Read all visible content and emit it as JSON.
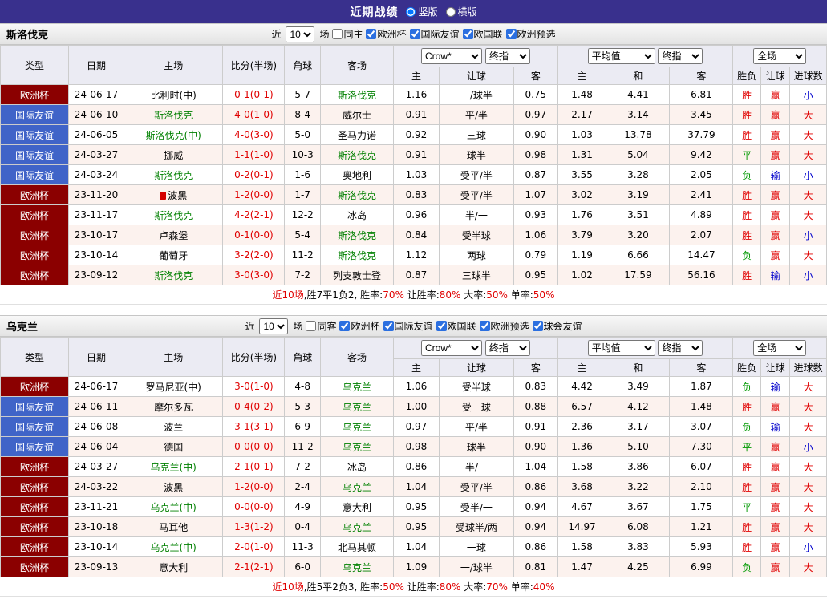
{
  "top_bar": {
    "title": "近期战绩",
    "layout_options": [
      {
        "label": "竖版",
        "selected": true
      },
      {
        "label": "横版",
        "selected": false
      }
    ]
  },
  "table_header": {
    "type": "类型",
    "date": "日期",
    "home": "主场",
    "score": "比分(半场)",
    "corner": "角球",
    "away": "客场",
    "ah_home": "主",
    "ah_line": "让球",
    "ah_away": "客",
    "eu_home": "主",
    "eu_draw": "和",
    "eu_away": "客",
    "res_wdl": "胜负",
    "res_handicap": "让球",
    "res_goals": "进球数",
    "select_company": "Crow*",
    "select_final": "终指",
    "select_average": "平均值",
    "select_fulltime": "全场"
  },
  "colors": {
    "euro_cup_bg": "#8b0000",
    "friendly_bg": "#4064c8",
    "focus_team_green": "#008000",
    "score_red": "#e00000",
    "win_red": "#e00000",
    "draw_lose_green": "#009900",
    "lose_small_blue": "#0000cc",
    "top_bar_purple": "#39308d"
  },
  "sections": [
    {
      "team": "斯洛伐克",
      "filter": {
        "near": "近",
        "count": "10",
        "unit": "场",
        "same": "同主",
        "same_checked": false,
        "leagues": [
          "欧洲杯",
          "国际友谊",
          "欧国联",
          "欧洲预选"
        ]
      },
      "rows": [
        {
          "type": "欧洲杯",
          "date": "24-06-17",
          "home": "比利时(中)",
          "home_focus": false,
          "home_icon": false,
          "score": "0-1(0-1)",
          "corner": "5-7",
          "away": "斯洛伐克",
          "away_focus": true,
          "odds": [
            "1.16",
            "一/球半",
            "0.75"
          ],
          "euro": [
            "1.48",
            "4.41",
            "6.81"
          ],
          "results": [
            "胜",
            "赢",
            "小"
          ]
        },
        {
          "type": "国际友谊",
          "date": "24-06-10",
          "home": "斯洛伐克",
          "home_focus": true,
          "home_icon": false,
          "score": "4-0(1-0)",
          "corner": "8-4",
          "away": "威尔士",
          "away_focus": false,
          "odds": [
            "0.91",
            "平/半",
            "0.97"
          ],
          "euro": [
            "2.17",
            "3.14",
            "3.45"
          ],
          "results": [
            "胜",
            "赢",
            "大"
          ]
        },
        {
          "type": "国际友谊",
          "date": "24-06-05",
          "home": "斯洛伐克(中)",
          "home_focus": true,
          "home_icon": false,
          "score": "4-0(3-0)",
          "corner": "5-0",
          "away": "圣马力诺",
          "away_focus": false,
          "odds": [
            "0.92",
            "三球",
            "0.90"
          ],
          "euro": [
            "1.03",
            "13.78",
            "37.79"
          ],
          "results": [
            "胜",
            "赢",
            "大"
          ]
        },
        {
          "type": "国际友谊",
          "date": "24-03-27",
          "home": "挪威",
          "home_focus": false,
          "home_icon": false,
          "score": "1-1(1-0)",
          "corner": "10-3",
          "away": "斯洛伐克",
          "away_focus": true,
          "odds": [
            "0.91",
            "球半",
            "0.98"
          ],
          "euro": [
            "1.31",
            "5.04",
            "9.42"
          ],
          "results": [
            "平",
            "赢",
            "大"
          ]
        },
        {
          "type": "国际友谊",
          "date": "24-03-24",
          "home": "斯洛伐克",
          "home_focus": true,
          "home_icon": false,
          "score": "0-2(0-1)",
          "corner": "1-6",
          "away": "奥地利",
          "away_focus": false,
          "odds": [
            "1.03",
            "受平/半",
            "0.87"
          ],
          "euro": [
            "3.55",
            "3.28",
            "2.05"
          ],
          "results": [
            "负",
            "输",
            "小"
          ]
        },
        {
          "type": "欧洲杯",
          "date": "23-11-20",
          "home": "波黑",
          "home_focus": false,
          "home_icon": true,
          "score": "1-2(0-0)",
          "corner": "1-7",
          "away": "斯洛伐克",
          "away_focus": true,
          "odds": [
            "0.83",
            "受平/半",
            "1.07"
          ],
          "euro": [
            "3.02",
            "3.19",
            "2.41"
          ],
          "results": [
            "胜",
            "赢",
            "大"
          ]
        },
        {
          "type": "欧洲杯",
          "date": "23-11-17",
          "home": "斯洛伐克",
          "home_focus": true,
          "home_icon": false,
          "score": "4-2(2-1)",
          "corner": "12-2",
          "away": "冰岛",
          "away_focus": false,
          "odds": [
            "0.96",
            "半/一",
            "0.93"
          ],
          "euro": [
            "1.76",
            "3.51",
            "4.89"
          ],
          "results": [
            "胜",
            "赢",
            "大"
          ]
        },
        {
          "type": "欧洲杯",
          "date": "23-10-17",
          "home": "卢森堡",
          "home_focus": false,
          "home_icon": false,
          "score": "0-1(0-0)",
          "corner": "5-4",
          "away": "斯洛伐克",
          "away_focus": true,
          "odds": [
            "0.84",
            "受半球",
            "1.06"
          ],
          "euro": [
            "3.79",
            "3.20",
            "2.07"
          ],
          "results": [
            "胜",
            "赢",
            "小"
          ]
        },
        {
          "type": "欧洲杯",
          "date": "23-10-14",
          "home": "葡萄牙",
          "home_focus": false,
          "home_icon": false,
          "score": "3-2(2-0)",
          "corner": "11-2",
          "away": "斯洛伐克",
          "away_focus": true,
          "odds": [
            "1.12",
            "两球",
            "0.79"
          ],
          "euro": [
            "1.19",
            "6.66",
            "14.47"
          ],
          "results": [
            "负",
            "赢",
            "大"
          ]
        },
        {
          "type": "欧洲杯",
          "date": "23-09-12",
          "home": "斯洛伐克",
          "home_focus": true,
          "home_icon": false,
          "score": "3-0(3-0)",
          "corner": "7-2",
          "away": "列支敦士登",
          "away_focus": false,
          "odds": [
            "0.87",
            "三球半",
            "0.95"
          ],
          "euro": [
            "1.02",
            "17.59",
            "56.16"
          ],
          "results": [
            "胜",
            "输",
            "小"
          ]
        }
      ],
      "summary": [
        {
          "t": "近10场",
          "c": "red"
        },
        {
          "t": ",胜7平1负2, 胜率:",
          "c": "black"
        },
        {
          "t": "70%",
          "c": "red"
        },
        {
          "t": " 让胜率:",
          "c": "black"
        },
        {
          "t": "80%",
          "c": "red"
        },
        {
          "t": " 大率:",
          "c": "black"
        },
        {
          "t": "50%",
          "c": "red"
        },
        {
          "t": " 单率:",
          "c": "black"
        },
        {
          "t": "50%",
          "c": "red"
        }
      ]
    },
    {
      "team": "乌克兰",
      "filter": {
        "near": "近",
        "count": "10",
        "unit": "场",
        "same": "同客",
        "same_checked": false,
        "leagues": [
          "欧洲杯",
          "国际友谊",
          "欧国联",
          "欧洲预选",
          "球会友谊"
        ]
      },
      "rows": [
        {
          "type": "欧洲杯",
          "date": "24-06-17",
          "home": "罗马尼亚(中)",
          "home_focus": false,
          "home_icon": false,
          "score": "3-0(1-0)",
          "corner": "4-8",
          "away": "乌克兰",
          "away_focus": true,
          "odds": [
            "1.06",
            "受半球",
            "0.83"
          ],
          "euro": [
            "4.42",
            "3.49",
            "1.87"
          ],
          "results": [
            "负",
            "输",
            "大"
          ]
        },
        {
          "type": "国际友谊",
          "date": "24-06-11",
          "home": "摩尔多瓦",
          "home_focus": false,
          "home_icon": false,
          "score": "0-4(0-2)",
          "corner": "5-3",
          "away": "乌克兰",
          "away_focus": true,
          "odds": [
            "1.00",
            "受一球",
            "0.88"
          ],
          "euro": [
            "6.57",
            "4.12",
            "1.48"
          ],
          "results": [
            "胜",
            "赢",
            "大"
          ]
        },
        {
          "type": "国际友谊",
          "date": "24-06-08",
          "home": "波兰",
          "home_focus": false,
          "home_icon": false,
          "score": "3-1(3-1)",
          "corner": "6-9",
          "away": "乌克兰",
          "away_focus": true,
          "odds": [
            "0.97",
            "平/半",
            "0.91"
          ],
          "euro": [
            "2.36",
            "3.17",
            "3.07"
          ],
          "results": [
            "负",
            "输",
            "大"
          ]
        },
        {
          "type": "国际友谊",
          "date": "24-06-04",
          "home": "德国",
          "home_focus": false,
          "home_icon": false,
          "score": "0-0(0-0)",
          "corner": "11-2",
          "away": "乌克兰",
          "away_focus": true,
          "odds": [
            "0.98",
            "球半",
            "0.90"
          ],
          "euro": [
            "1.36",
            "5.10",
            "7.30"
          ],
          "results": [
            "平",
            "赢",
            "小"
          ]
        },
        {
          "type": "欧洲杯",
          "date": "24-03-27",
          "home": "乌克兰(中)",
          "home_focus": true,
          "home_icon": false,
          "score": "2-1(0-1)",
          "corner": "7-2",
          "away": "冰岛",
          "away_focus": false,
          "odds": [
            "0.86",
            "半/一",
            "1.04"
          ],
          "euro": [
            "1.58",
            "3.86",
            "6.07"
          ],
          "results": [
            "胜",
            "赢",
            "大"
          ]
        },
        {
          "type": "欧洲杯",
          "date": "24-03-22",
          "home": "波黑",
          "home_focus": false,
          "home_icon": false,
          "score": "1-2(0-0)",
          "corner": "2-4",
          "away": "乌克兰",
          "away_focus": true,
          "odds": [
            "1.04",
            "受平/半",
            "0.86"
          ],
          "euro": [
            "3.68",
            "3.22",
            "2.10"
          ],
          "results": [
            "胜",
            "赢",
            "大"
          ]
        },
        {
          "type": "欧洲杯",
          "date": "23-11-21",
          "home": "乌克兰(中)",
          "home_focus": true,
          "home_icon": false,
          "score": "0-0(0-0)",
          "corner": "4-9",
          "away": "意大利",
          "away_focus": false,
          "odds": [
            "0.95",
            "受半/一",
            "0.94"
          ],
          "euro": [
            "4.67",
            "3.67",
            "1.75"
          ],
          "results": [
            "平",
            "赢",
            "大"
          ]
        },
        {
          "type": "欧洲杯",
          "date": "23-10-18",
          "home": "马耳他",
          "home_focus": false,
          "home_icon": false,
          "score": "1-3(1-2)",
          "corner": "0-4",
          "away": "乌克兰",
          "away_focus": true,
          "odds": [
            "0.95",
            "受球半/两",
            "0.94"
          ],
          "euro": [
            "14.97",
            "6.08",
            "1.21"
          ],
          "results": [
            "胜",
            "赢",
            "大"
          ]
        },
        {
          "type": "欧洲杯",
          "date": "23-10-14",
          "home": "乌克兰(中)",
          "home_focus": true,
          "home_icon": false,
          "score": "2-0(1-0)",
          "corner": "11-3",
          "away": "北马其顿",
          "away_focus": false,
          "odds": [
            "1.04",
            "一球",
            "0.86"
          ],
          "euro": [
            "1.58",
            "3.83",
            "5.93"
          ],
          "results": [
            "胜",
            "赢",
            "小"
          ]
        },
        {
          "type": "欧洲杯",
          "date": "23-09-13",
          "home": "意大利",
          "home_focus": false,
          "home_icon": false,
          "score": "2-1(2-1)",
          "corner": "6-0",
          "away": "乌克兰",
          "away_focus": true,
          "odds": [
            "1.09",
            "一/球半",
            "0.81"
          ],
          "euro": [
            "1.47",
            "4.25",
            "6.99"
          ],
          "results": [
            "负",
            "赢",
            "大"
          ]
        }
      ],
      "summary": [
        {
          "t": "近10场",
          "c": "red"
        },
        {
          "t": ",胜5平2负3, 胜率:",
          "c": "black"
        },
        {
          "t": "50%",
          "c": "red"
        },
        {
          "t": " 让胜率:",
          "c": "black"
        },
        {
          "t": "80%",
          "c": "red"
        },
        {
          "t": " 大率:",
          "c": "black"
        },
        {
          "t": "70%",
          "c": "red"
        },
        {
          "t": " 单率:",
          "c": "black"
        },
        {
          "t": "40%",
          "c": "red"
        }
      ]
    }
  ]
}
